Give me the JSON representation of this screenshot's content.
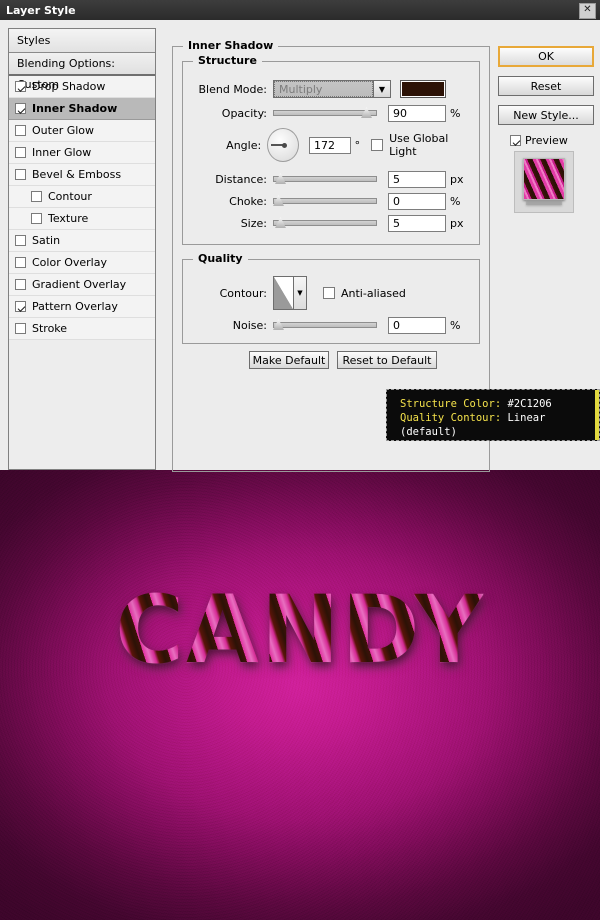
{
  "dialog": {
    "title": "Layer Style",
    "close_icon": "close-icon"
  },
  "styles_panel": {
    "header": "Styles",
    "blending_options": "Blending Options: Custom",
    "items": [
      {
        "label": "Drop Shadow",
        "checked": true,
        "selected": false,
        "indent": false
      },
      {
        "label": "Inner Shadow",
        "checked": true,
        "selected": true,
        "indent": false
      },
      {
        "label": "Outer Glow",
        "checked": false,
        "selected": false,
        "indent": false
      },
      {
        "label": "Inner Glow",
        "checked": false,
        "selected": false,
        "indent": false
      },
      {
        "label": "Bevel & Emboss",
        "checked": false,
        "selected": false,
        "indent": false
      },
      {
        "label": "Contour",
        "checked": false,
        "selected": false,
        "indent": true
      },
      {
        "label": "Texture",
        "checked": false,
        "selected": false,
        "indent": true
      },
      {
        "label": "Satin",
        "checked": false,
        "selected": false,
        "indent": false
      },
      {
        "label": "Color Overlay",
        "checked": false,
        "selected": false,
        "indent": false
      },
      {
        "label": "Gradient Overlay",
        "checked": false,
        "selected": false,
        "indent": false
      },
      {
        "label": "Pattern Overlay",
        "checked": true,
        "selected": false,
        "indent": false
      },
      {
        "label": "Stroke",
        "checked": false,
        "selected": false,
        "indent": false
      }
    ]
  },
  "panel": {
    "title": "Inner Shadow",
    "structure": {
      "legend": "Structure",
      "blend_mode_label": "Blend Mode:",
      "blend_mode_value": "Multiply",
      "blend_mode_arrow_icon": "chevron-down-icon",
      "color_swatch": "#2C1206",
      "opacity_label": "Opacity:",
      "opacity_value": "90",
      "opacity_unit": "%",
      "angle_label": "Angle:",
      "angle_value": "172",
      "angle_unit": "°",
      "angle_dial_icon": "angle-dial-icon",
      "use_global_light_label": "Use Global Light",
      "use_global_light_checked": false,
      "distance_label": "Distance:",
      "distance_value": "5",
      "distance_unit": "px",
      "choke_label": "Choke:",
      "choke_value": "0",
      "choke_unit": "%",
      "size_label": "Size:",
      "size_value": "5",
      "size_unit": "px"
    },
    "quality": {
      "legend": "Quality",
      "contour_label": "Contour:",
      "contour_preview_icon": "contour-curve-icon",
      "contour_arrow_icon": "chevron-down-icon",
      "anti_aliased_label": "Anti-aliased",
      "anti_aliased_checked": false,
      "noise_label": "Noise:",
      "noise_value": "0",
      "noise_unit": "%"
    },
    "make_default": "Make Default",
    "reset_to_default": "Reset to Default"
  },
  "right_column": {
    "ok": "OK",
    "reset": "Reset",
    "new_style": "New Style...",
    "preview_label": "Preview",
    "preview_checked": true,
    "preview_thumbnail_icon": "style-preview-thumbnail"
  },
  "annotation": {
    "line1_key": "Structure Color:",
    "line1_value": "#2C1206",
    "line2_key": "Quality Contour:",
    "line2_value": "Linear (default)"
  },
  "artwork": {
    "word": "CANDY"
  }
}
